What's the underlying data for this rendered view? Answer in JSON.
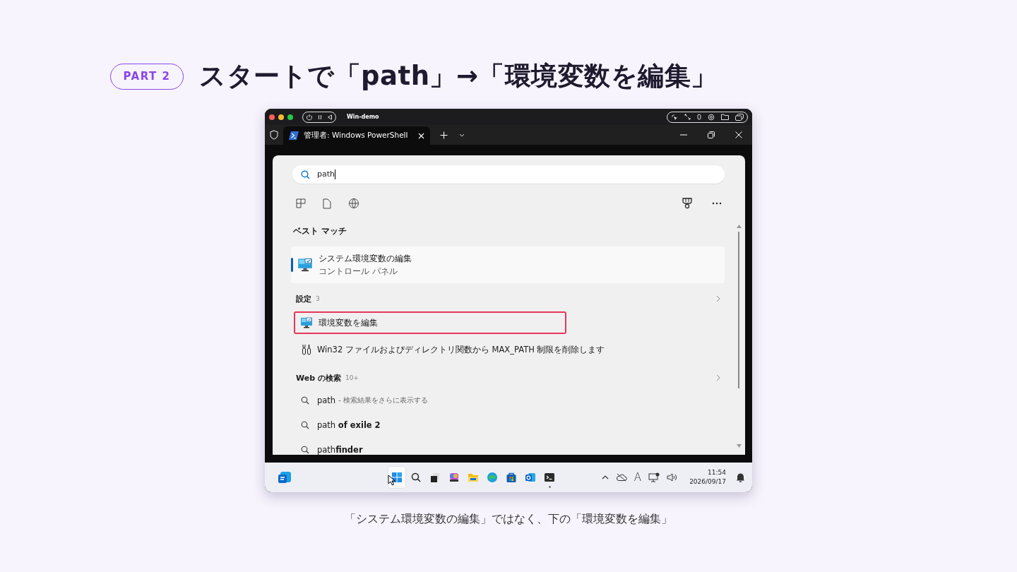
{
  "badge": "PART 2",
  "title": "スタートで「path」→「環境変数を編集」",
  "vm_window": {
    "title": "Win-demo"
  },
  "terminal": {
    "tab": {
      "title": "管理者: Windows PowerShell",
      "selected": true
    }
  },
  "search_panel": {
    "query": "path",
    "best_match": {
      "heading": "ベスト マッチ",
      "title": "システム環境変数の編集",
      "subtitle": "コントロール パネル",
      "selected": true
    },
    "settings": {
      "heading": "設定",
      "count": "3",
      "items": [
        {
          "kind": "monitor",
          "label": "環境変数を編集",
          "highlighted": true
        },
        {
          "kind": "wrench",
          "label": "Win32 ファイルおよびディレクトリ関数から MAX_PATH 制限を削除します",
          "highlighted": false
        }
      ]
    },
    "web": {
      "heading": "Web の検索",
      "count": "10+",
      "items": [
        {
          "text": "path",
          "suffix": "- 検索結果をさらに表示する"
        },
        {
          "text": "path **of exile 2**"
        },
        {
          "text": "path**finder**"
        }
      ]
    }
  },
  "taskbar": {
    "apps": [
      {
        "kind": "start",
        "selected": true,
        "running": false
      },
      {
        "kind": "search",
        "selected": false,
        "running": false
      },
      {
        "kind": "taskview",
        "selected": false,
        "running": false
      },
      {
        "kind": "copilot",
        "selected": false,
        "running": false
      },
      {
        "kind": "explorer",
        "selected": false,
        "running": false
      },
      {
        "kind": "edge",
        "selected": false,
        "running": false
      },
      {
        "kind": "store",
        "selected": false,
        "running": false
      },
      {
        "kind": "outlook",
        "selected": false,
        "running": false
      },
      {
        "kind": "terminal",
        "selected": false,
        "running": true
      }
    ],
    "ime": "A",
    "time": "11:54",
    "date": "2026/09/17"
  },
  "caption": "「システム環境変数の編集」ではなく、下の「環境変数を編集」"
}
